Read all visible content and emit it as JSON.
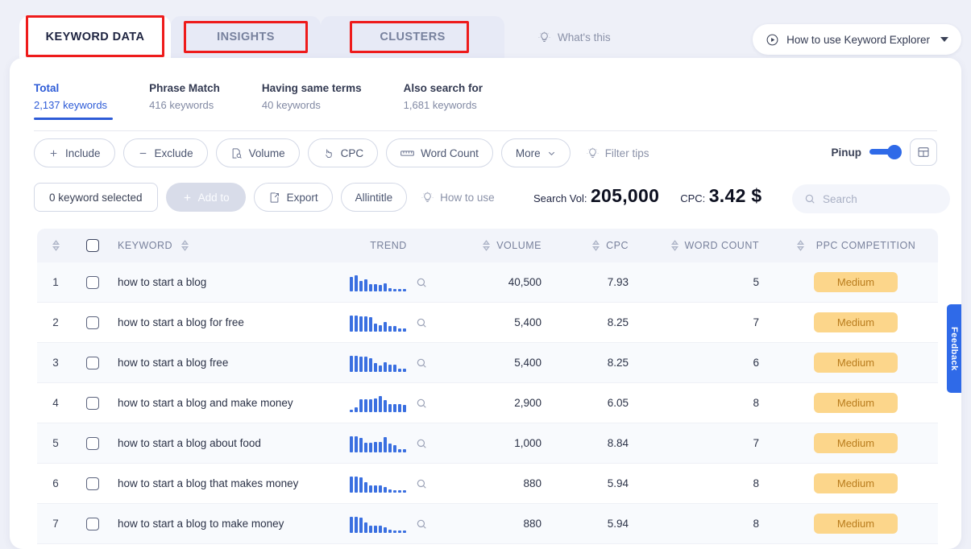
{
  "tabs": [
    {
      "label": "KEYWORD DATA",
      "active": true
    },
    {
      "label": "INSIGHTS",
      "active": false
    },
    {
      "label": "CLUSTERS",
      "active": false
    }
  ],
  "header": {
    "whats_this": "What's this",
    "howto": "How to use Keyword Explorer",
    "whats_this_icon": "lightbulb-icon",
    "howto_icon": "play-circle-icon",
    "howto_caret_icon": "chevron-down-icon"
  },
  "subtabs": [
    {
      "title": "Total",
      "sub": "2,137 keywords",
      "active": true
    },
    {
      "title": "Phrase Match",
      "sub": "416 keywords",
      "active": false
    },
    {
      "title": "Having same terms",
      "sub": "40 keywords",
      "active": false
    },
    {
      "title": "Also search for",
      "sub": "1,681 keywords",
      "active": false
    }
  ],
  "filters": [
    {
      "label": "Include",
      "icon": "plus-icon"
    },
    {
      "label": "Exclude",
      "icon": "minus-icon"
    },
    {
      "label": "Volume",
      "icon": "volume-search-icon"
    },
    {
      "label": "CPC",
      "icon": "click-cursor-icon"
    },
    {
      "label": "Word Count",
      "icon": "ruler-icon"
    },
    {
      "label": "More",
      "icon": "chevron-down-icon"
    }
  ],
  "filter_tips": "Filter tips",
  "pinup": {
    "label": "Pinup",
    "on": true,
    "layout_icon": "layout-columns-icon"
  },
  "actions": {
    "selected": "0 keyword selected",
    "add_to": "Add to",
    "export": "Export",
    "allintitle": "Allintitle",
    "how_to_use": "How to use"
  },
  "stats": {
    "volume_label": "Search Vol:",
    "volume_value": "205,000",
    "cpc_label": "CPC:",
    "cpc_value": "3.42 $"
  },
  "search": {
    "placeholder": "Search",
    "value": "",
    "icon": "search-icon"
  },
  "table": {
    "columns": [
      "KEYWORD",
      "TREND",
      "VOLUME",
      "CPC",
      "WORD COUNT",
      "PPC COMPETITION"
    ],
    "rows": [
      {
        "n": "1",
        "keyword": "how to start a blog",
        "volume": "40,500",
        "cpc": "7.93",
        "words": "5",
        "ppc": "Medium",
        "spark": [
          18,
          20,
          13,
          15,
          9,
          9,
          8,
          10,
          4,
          3,
          3,
          3
        ]
      },
      {
        "n": "2",
        "keyword": "how to start a blog for free",
        "volume": "5,400",
        "cpc": "8.25",
        "words": "7",
        "ppc": "Medium",
        "spark": [
          20,
          20,
          19,
          19,
          18,
          10,
          8,
          12,
          7,
          7,
          4,
          4
        ]
      },
      {
        "n": "3",
        "keyword": "how to start a blog free",
        "volume": "5,400",
        "cpc": "8.25",
        "words": "6",
        "ppc": "Medium",
        "spark": [
          20,
          20,
          19,
          19,
          17,
          11,
          8,
          12,
          9,
          9,
          4,
          4
        ]
      },
      {
        "n": "4",
        "keyword": "how to start a blog and make money",
        "volume": "2,900",
        "cpc": "6.05",
        "words": "8",
        "ppc": "Medium",
        "spark": [
          3,
          6,
          16,
          16,
          16,
          17,
          20,
          15,
          10,
          10,
          10,
          9
        ]
      },
      {
        "n": "5",
        "keyword": "how to start a blog about food",
        "volume": "1,000",
        "cpc": "8.84",
        "words": "7",
        "ppc": "Medium",
        "spark": [
          20,
          20,
          18,
          12,
          12,
          13,
          13,
          19,
          11,
          9,
          4,
          4
        ]
      },
      {
        "n": "6",
        "keyword": "how to start a blog that makes money",
        "volume": "880",
        "cpc": "5.94",
        "words": "8",
        "ppc": "Medium",
        "spark": [
          20,
          20,
          19,
          13,
          9,
          9,
          9,
          7,
          4,
          3,
          3,
          3
        ]
      },
      {
        "n": "7",
        "keyword": "how to start a blog to make money",
        "volume": "880",
        "cpc": "5.94",
        "words": "8",
        "ppc": "Medium",
        "spark": [
          20,
          20,
          19,
          13,
          9,
          9,
          9,
          7,
          4,
          3,
          3,
          3
        ]
      }
    ]
  },
  "feedback": {
    "label": "Feedback",
    "icon": "star-icon"
  },
  "colors": {
    "accent": "#2d5bd7",
    "badge_bg": "#fcd68b",
    "badge_text": "#b97c1d",
    "annotation": "#ee1b1b"
  }
}
